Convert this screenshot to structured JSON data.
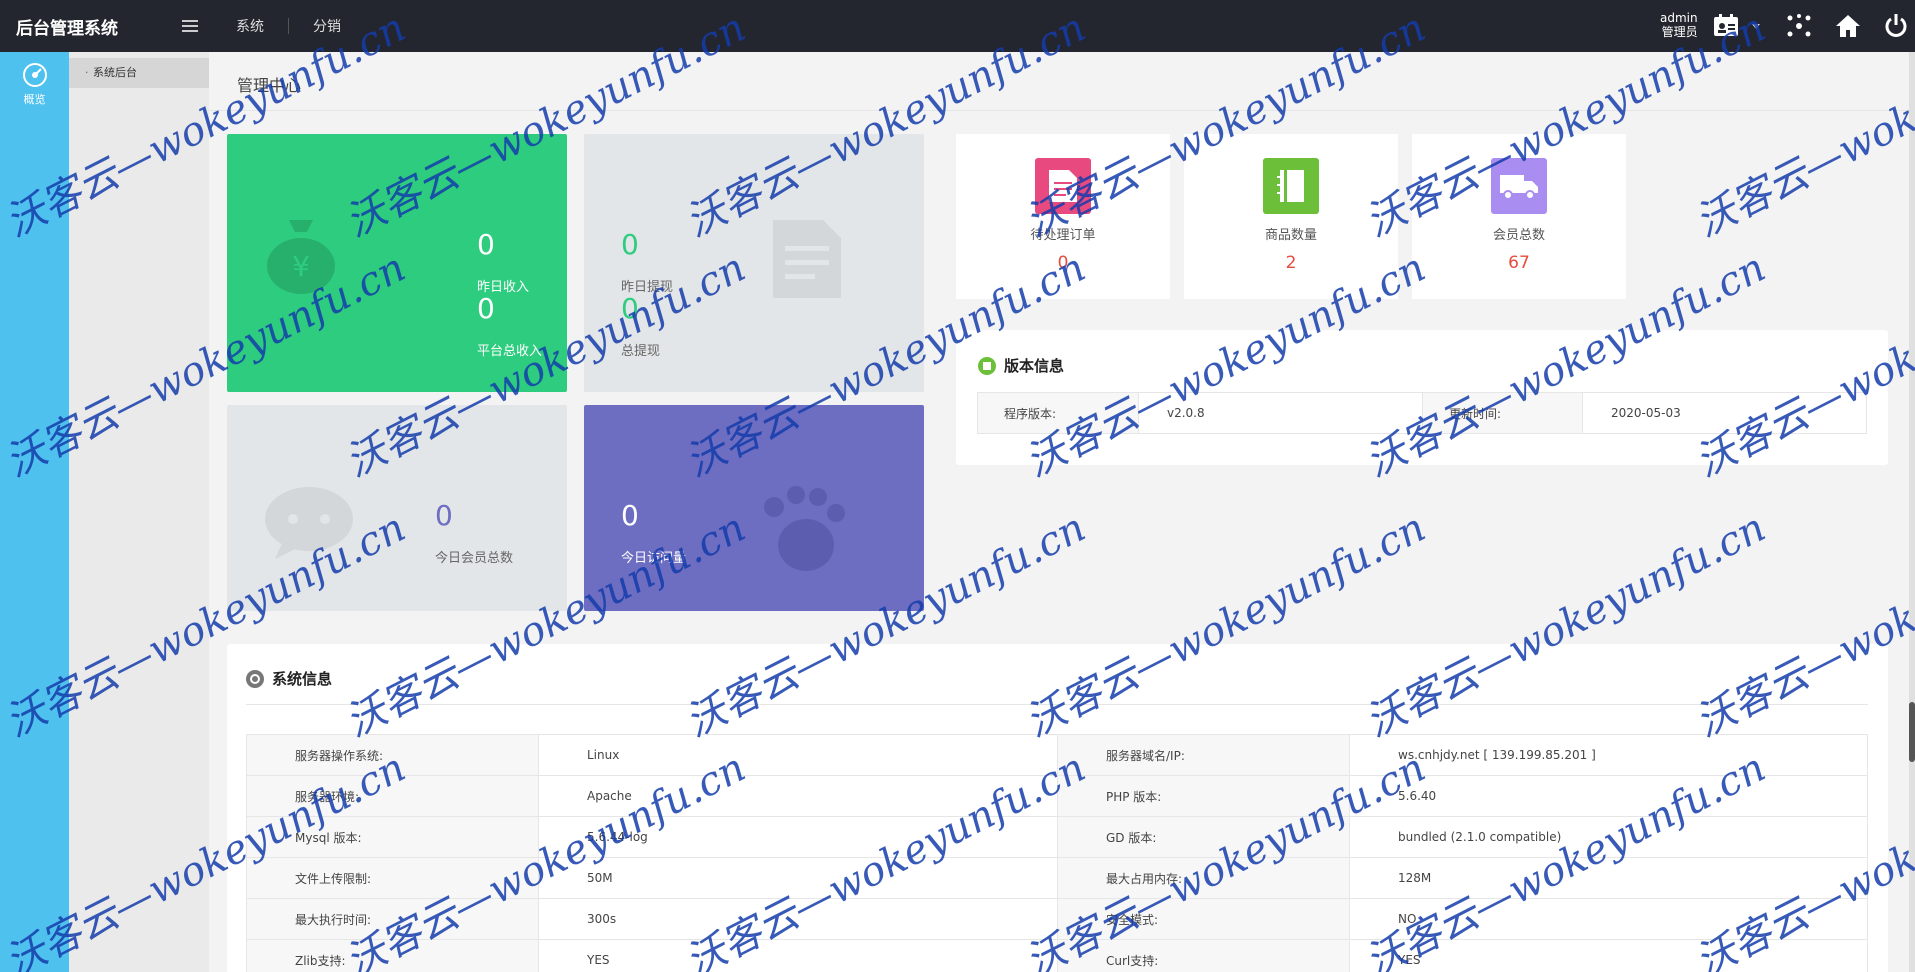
{
  "app": {
    "title": "后台管理系统"
  },
  "top_nav": [
    {
      "label": "系统"
    },
    {
      "label": "分销"
    }
  ],
  "user": {
    "name": "admin",
    "role": "管理员"
  },
  "rail": {
    "active_label": "概览"
  },
  "subnav": {
    "active_label": "系统后台"
  },
  "page": {
    "title": "管理中心"
  },
  "tiles": {
    "income": {
      "yesterday_value": "0",
      "yesterday_label": "昨日收入",
      "total_value": "0",
      "total_label": "平台总收入",
      "color": "#2ecc7e"
    },
    "withdraw": {
      "yesterday_value": "0",
      "yesterday_label": "昨日提现",
      "total_value": "0",
      "total_label": "总提现",
      "color": "#e3e6e8"
    },
    "members": {
      "value": "0",
      "label": "今日会员总数",
      "color": "#e3e6e8"
    },
    "visits": {
      "value": "0",
      "label": "今日访问量",
      "color": "#6d6dc2"
    }
  },
  "stats": [
    {
      "label": "待处理订单",
      "value": "0",
      "icon": "document-icon",
      "color": "#e84a7f"
    },
    {
      "label": "商品数量",
      "value": "2",
      "icon": "notebook-icon",
      "color": "#6cc039"
    },
    {
      "label": "会员总数",
      "value": "67",
      "icon": "truck-icon",
      "color": "#a98df0"
    }
  ],
  "version": {
    "heading": "版本信息",
    "program_label": "程序版本:",
    "program_value": "v2.0.8",
    "updated_label": "更新时间:",
    "updated_value": "2020-05-03"
  },
  "system": {
    "heading": "系统信息",
    "rows": [
      {
        "k1": "服务器操作系统:",
        "v1": "Linux",
        "k2": "服务器域名/IP:",
        "v2": "ws.cnhjdy.net [ 139.199.85.201 ]"
      },
      {
        "k1": "服务器环境:",
        "v1": "Apache",
        "k2": "PHP 版本:",
        "v2": "5.6.40"
      },
      {
        "k1": "Mysql 版本:",
        "v1": "5.6.44-log",
        "k2": "GD 版本:",
        "v2": "bundled (2.1.0 compatible)"
      },
      {
        "k1": "文件上传限制:",
        "v1": "50M",
        "k2": "最大占用内存:",
        "v2": "128M"
      },
      {
        "k1": "最大执行时间:",
        "v1": "300s",
        "k2": "安全模式:",
        "v2": "NO"
      },
      {
        "k1": "Zlib支持:",
        "v1": "YES",
        "k2": "Curl支持:",
        "v2": "YES"
      }
    ]
  },
  "watermark": {
    "text": "沃客云—wokeyunfu.cn"
  }
}
